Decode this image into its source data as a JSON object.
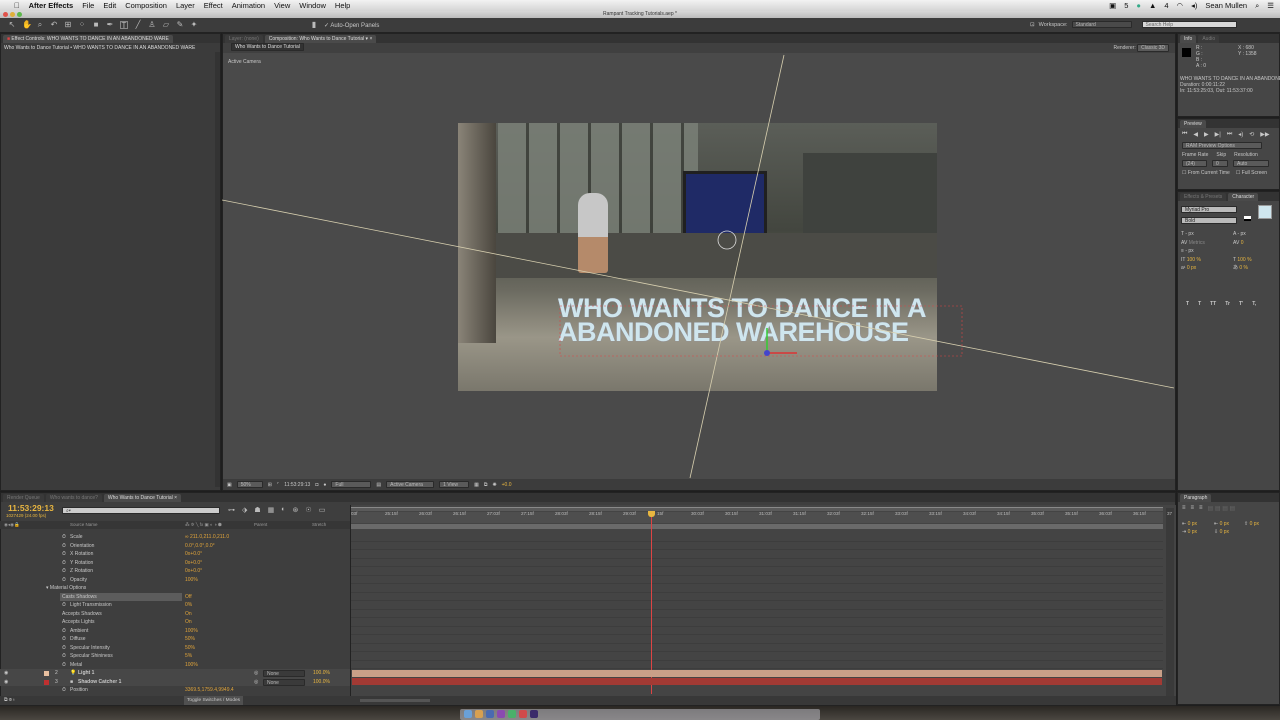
{
  "menubar": {
    "apple": "",
    "items": [
      "After Effects",
      "File",
      "Edit",
      "Composition",
      "Layer",
      "Effect",
      "Animation",
      "View",
      "Window",
      "Help"
    ],
    "user": "Sean Mullen",
    "badge1": "5",
    "badge2": "4"
  },
  "window": {
    "title": "Rampant Tracking Tutorials.aep *"
  },
  "toolbar": {
    "auto_open": "Auto-Open Panels",
    "workspace_label": "Workspace:",
    "workspace": "Standard",
    "search_placeholder": "Search Help"
  },
  "effect_controls": {
    "tab": "Effect Controls: WHO WANTS TO DANCE IN AN ABANDONED WARE",
    "breadcrumb": "Who Wants to Dance Tutorial • WHO WANTS TO DANCE IN AN ABANDONED WARE"
  },
  "composition": {
    "layer_tab": "Layer: (none)",
    "tab": "Composition: Who Wants to Dance Tutorial",
    "comp_name_tab": "Who Wants to Dance Tutorial",
    "renderer_label": "Renderer:",
    "renderer": "Classic 3D",
    "view_label": "Active Camera",
    "overlay_line1": "WHO WANTS TO DANCE IN A",
    "overlay_line2": "ABANDONED WAREHOUSE",
    "footer": {
      "zoom": "50%",
      "timecode": "11:53:29:13",
      "resolution": "Full",
      "camera": "Active Camera",
      "views": "1 View",
      "exposure": "+0.0"
    }
  },
  "info": {
    "tab": "Info",
    "tab2": "Audio",
    "r": "R :",
    "g": "G :",
    "b": "B :",
    "a": "A : 0",
    "x": "X : 680",
    "y": "Y : 1358",
    "layer": "WHO WANTS TO DANCE IN AN ABANDONED WAREHOUSE",
    "duration": "Duration: 0:00:11:22",
    "inout": "In: 11:53:25:03, Out: 11:53:37:00"
  },
  "preview": {
    "tab": "Preview",
    "ram": "RAM Preview Options",
    "fr_label": "Frame Rate",
    "skip_label": "Skip",
    "res_label": "Resolution",
    "fr": "(24)",
    "skip": "0",
    "res": "Auto",
    "from_current": "From Current Time",
    "full_screen": "Full Screen"
  },
  "character": {
    "tab1": "Effects & Presets",
    "tab2": "Character",
    "font": "Myriad Pro",
    "style": "Bold",
    "size": "- px",
    "leading": "- px",
    "kerning": "Metrics",
    "tracking": "0",
    "stroke": "- px",
    "vscale": "100 %",
    "hscale": "100 %",
    "baseline": "0 px",
    "tsume": "0 %",
    "fill_color": "#cfe6ee",
    "buttons": [
      "T",
      "T",
      "TT",
      "Tr",
      "T'",
      "T,"
    ]
  },
  "paragraph": {
    "tab": "Paragraph",
    "fields": [
      "0 px",
      "0 px",
      "0 px",
      "0 px",
      "0 px"
    ]
  },
  "timeline": {
    "tabs": [
      "Render Queue",
      "Who wants to dance?",
      "Who Wants to Dance Tutorial"
    ],
    "timecode": "11:53:29:13",
    "frame": "1027429 (24.00 fps)",
    "search_placeholder": "⌕▾",
    "col_source": "Source Name",
    "col_parent": "Parent",
    "col_stretch": "Stretch",
    "toggle_label": "Toggle Switches / Modes",
    "properties": [
      {
        "name": "Scale",
        "value": "∞ 211.0,211.0,211.0",
        "indent": 2
      },
      {
        "name": "Orientation",
        "value": "0.0°,0.0°,0.0°",
        "indent": 2
      },
      {
        "name": "X Rotation",
        "value": "0x+0.0°",
        "indent": 2
      },
      {
        "name": "Y Rotation",
        "value": "0x+0.0°",
        "indent": 2
      },
      {
        "name": "Z Rotation",
        "value": "0x+0.0°",
        "indent": 2
      },
      {
        "name": "Opacity",
        "value": "100%",
        "indent": 2
      },
      {
        "name": "▾ Material Options",
        "value": "",
        "indent": 1
      },
      {
        "name": "Casts Shadows",
        "value": "Off",
        "indent": 3
      },
      {
        "name": "Light Transmission",
        "value": "0%",
        "indent": 2
      },
      {
        "name": "Accepts Shadows",
        "value": "On",
        "indent": 3
      },
      {
        "name": "Accepts Lights",
        "value": "On",
        "indent": 3
      },
      {
        "name": "Ambient",
        "value": "100%",
        "indent": 2
      },
      {
        "name": "Diffuse",
        "value": "50%",
        "indent": 2
      },
      {
        "name": "Specular Intensity",
        "value": "50%",
        "indent": 2
      },
      {
        "name": "Specular Shininess",
        "value": "5%",
        "indent": 2
      },
      {
        "name": "Metal",
        "value": "100%",
        "indent": 2
      }
    ],
    "layers": [
      {
        "num": "2",
        "name": "Light 1",
        "parent": "None",
        "stretch": "100.0%",
        "color": "#e8c0a0"
      },
      {
        "num": "3",
        "name": "Shadow Catcher 1",
        "parent": "None",
        "stretch": "100.0%",
        "color": "#c03030"
      }
    ],
    "position": {
      "name": "Position",
      "value": "3369.5,1759.4,9949.4"
    },
    "ruler": [
      "03f",
      "25:15f",
      "26:03f",
      "26:15f",
      "27:03f",
      "27:15f",
      "28:03f",
      "28:15f",
      "29:03f",
      "15f",
      "30:03f",
      "30:15f",
      "31:03f",
      "31:15f",
      "32:03f",
      "32:15f",
      "33:03f",
      "33:15f",
      "34:03f",
      "34:15f",
      "35:03f",
      "35:15f",
      "36:03f",
      "36:15f",
      "37"
    ],
    "current_time_fraction": 0.37
  }
}
